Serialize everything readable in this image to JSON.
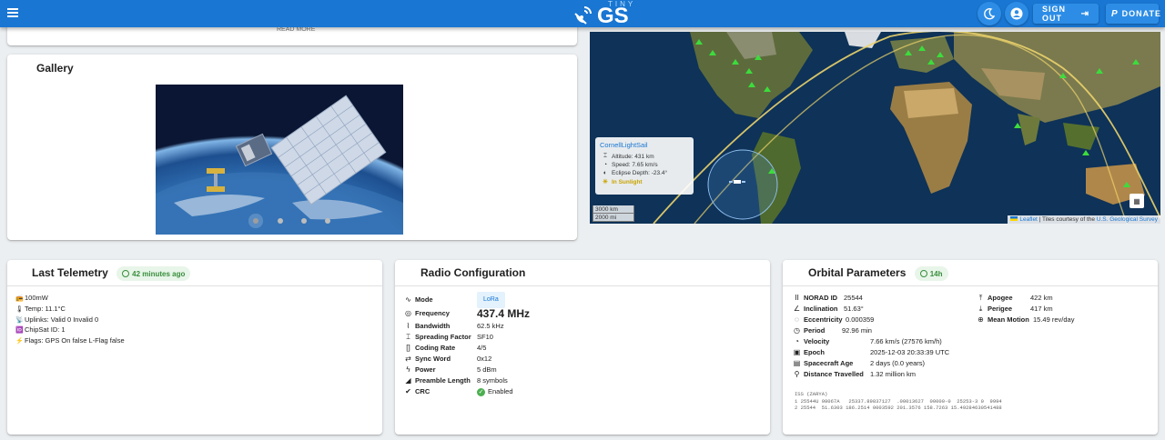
{
  "header": {
    "logo_small": "TINY",
    "logo_big": "GS",
    "theme_icon": "moon-icon",
    "account_icon": "account-icon",
    "sign_out_label": "SIGN OUT",
    "donate_label": "DONATE",
    "colors": {
      "bar": "#1976d2",
      "button": "#2d8de6"
    }
  },
  "top_card": {
    "partial_text": "READ MORE"
  },
  "gallery": {
    "title": "Gallery",
    "slide_count": 4,
    "active_slide": 1
  },
  "map": {
    "popup": {
      "satellite": "CornellLightSail",
      "altitude": "Altitude: 431 km",
      "speed": "Speed: 7.65 km/s",
      "eclipse": "Eclipse Depth: -23.4°",
      "sunlight": "In Sunlight"
    },
    "scale_km": "3000 km",
    "scale_mi": "2000 mi",
    "attribution_leaflet": "Leaflet",
    "attribution_text": " | Tiles courtesy of the ",
    "attribution_link": "U.S. Geological Survey"
  },
  "telemetry": {
    "title": "Last Telemetry",
    "age": "42 minutes ago",
    "rows": [
      {
        "icon": "radio-icon",
        "text": "100mW"
      },
      {
        "icon": "thermometer-icon",
        "text": "Temp: 11.1°C"
      },
      {
        "icon": "satellite-dish-icon",
        "text": "Uplinks: Valid 0 Invalid 0"
      },
      {
        "icon": "id-icon",
        "text": "ChipSat ID: 1"
      },
      {
        "icon": "lightning-icon",
        "text": "Flags: GPS On false L-Flag false"
      }
    ]
  },
  "radio": {
    "title": "Radio Configuration",
    "rows": [
      {
        "label": "Mode",
        "value": "LoRa"
      },
      {
        "label": "Frequency",
        "value": "437.4 MHz"
      },
      {
        "label": "Bandwidth",
        "value": "62.5 kHz"
      },
      {
        "label": "Spreading Factor",
        "value": "SF10"
      },
      {
        "label": "Coding Rate",
        "value": "4/5"
      },
      {
        "label": "Sync Word",
        "value": "0x12"
      },
      {
        "label": "Power",
        "value": "5 dBm"
      },
      {
        "label": "Preamble Length",
        "value": "8 symbols"
      },
      {
        "label": "CRC",
        "value": "Enabled"
      }
    ]
  },
  "orbit": {
    "title": "Orbital Parameters",
    "age": "14h",
    "left": [
      {
        "label": "NORAD ID",
        "value": "25544"
      },
      {
        "label": "Inclination",
        "value": "51.63°"
      },
      {
        "label": "Eccentricity",
        "value": "0.000359"
      },
      {
        "label": "Period",
        "value": "92.96 min"
      },
      {
        "label": "Velocity",
        "value": "7.66 km/s (27576 km/h)"
      },
      {
        "label": "Epoch",
        "value": "2025-12-03 20:33:39 UTC"
      },
      {
        "label": "Spacecraft Age",
        "value": "2 days (0.0 years)"
      },
      {
        "label": "Distance Travelled",
        "value": "1.32 million km"
      }
    ],
    "right": [
      {
        "label": "Apogee",
        "value": "422 km"
      },
      {
        "label": "Perigee",
        "value": "417 km"
      },
      {
        "label": "Mean Motion",
        "value": "15.49 rev/day"
      }
    ],
    "tle": [
      "ISS (ZARYA)",
      "1 25544U 98067A   25337.89837127  .00013627  00000-0  25253-3 0  9994",
      "2 25544  51.6303 186.2514 0003592 201.3576 158.7263 15.49284630541488"
    ]
  }
}
